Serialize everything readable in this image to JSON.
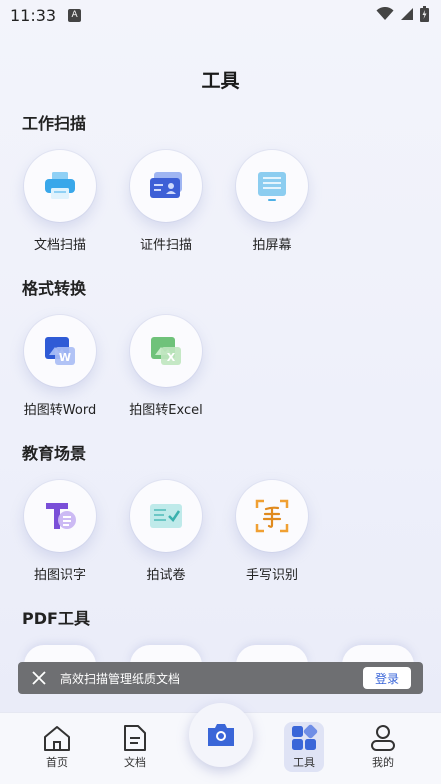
{
  "status": {
    "time": "11:33",
    "indicator": "A"
  },
  "page": {
    "title": "工具"
  },
  "sections": [
    {
      "title": "工作扫描",
      "tools": [
        {
          "label": "文档扫描",
          "icon": "printer-icon"
        },
        {
          "label": "证件扫描",
          "icon": "id-card-icon"
        },
        {
          "label": "拍屏幕",
          "icon": "screen-icon"
        }
      ]
    },
    {
      "title": "格式转换",
      "tools": [
        {
          "label": "拍图转Word",
          "icon": "word-icon"
        },
        {
          "label": "拍图转Excel",
          "icon": "excel-icon"
        }
      ]
    },
    {
      "title": "教育场景",
      "tools": [
        {
          "label": "拍图识字",
          "icon": "text-recognition-icon"
        },
        {
          "label": "拍试卷",
          "icon": "exam-paper-icon"
        },
        {
          "label": "手写识别",
          "icon": "handwriting-icon"
        }
      ]
    },
    {
      "title": "PDF工具",
      "tools": []
    }
  ],
  "toast": {
    "text": "高效扫描管理纸质文档",
    "login_label": "登录"
  },
  "nav": {
    "home": "首页",
    "docs": "文档",
    "tools": "工具",
    "mine": "我的",
    "active": "工具"
  },
  "colors": {
    "accent": "#3a66d8",
    "toast_bg": "#6e6f72"
  }
}
